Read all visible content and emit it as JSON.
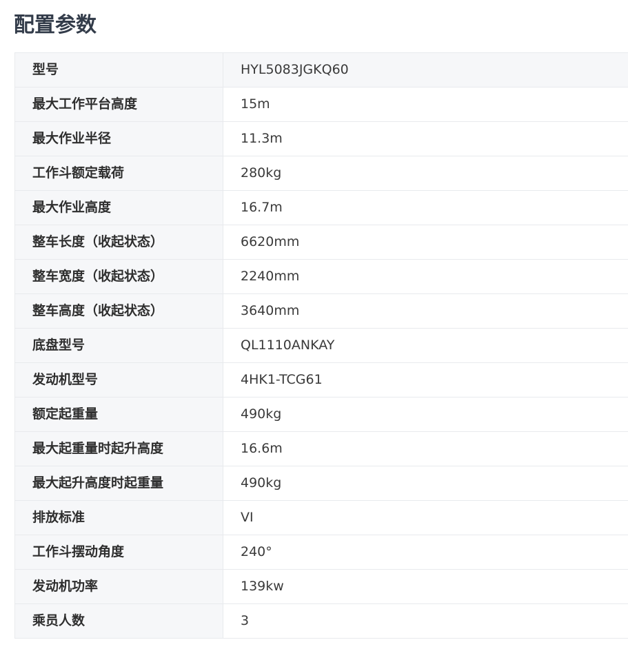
{
  "title": "配置参数",
  "specs": [
    {
      "label": "型号",
      "value": "HYL5083JGKQ60"
    },
    {
      "label": "最大工作平台高度",
      "value": "15m"
    },
    {
      "label": "最大作业半径",
      "value": "11.3m"
    },
    {
      "label": "工作斗额定载荷",
      "value": "280kg"
    },
    {
      "label": "最大作业高度",
      "value": "16.7m"
    },
    {
      "label": "整车长度（收起状态）",
      "value": "6620mm"
    },
    {
      "label": "整车宽度（收起状态）",
      "value": "2240mm"
    },
    {
      "label": "整车高度（收起状态）",
      "value": "3640mm"
    },
    {
      "label": "底盘型号",
      "value": "QL1110ANKAY"
    },
    {
      "label": "发动机型号",
      "value": "4HK1-TCG61"
    },
    {
      "label": "额定起重量",
      "value": "490kg"
    },
    {
      "label": "最大起重量时起升高度",
      "value": "16.6m"
    },
    {
      "label": "最大起升高度时起重量",
      "value": "490kg"
    },
    {
      "label": "排放标准",
      "value": "VI"
    },
    {
      "label": "工作斗摆动角度",
      "value": "240°"
    },
    {
      "label": "发动机功率",
      "value": "139kw"
    },
    {
      "label": "乘员人数",
      "value": "3"
    }
  ]
}
